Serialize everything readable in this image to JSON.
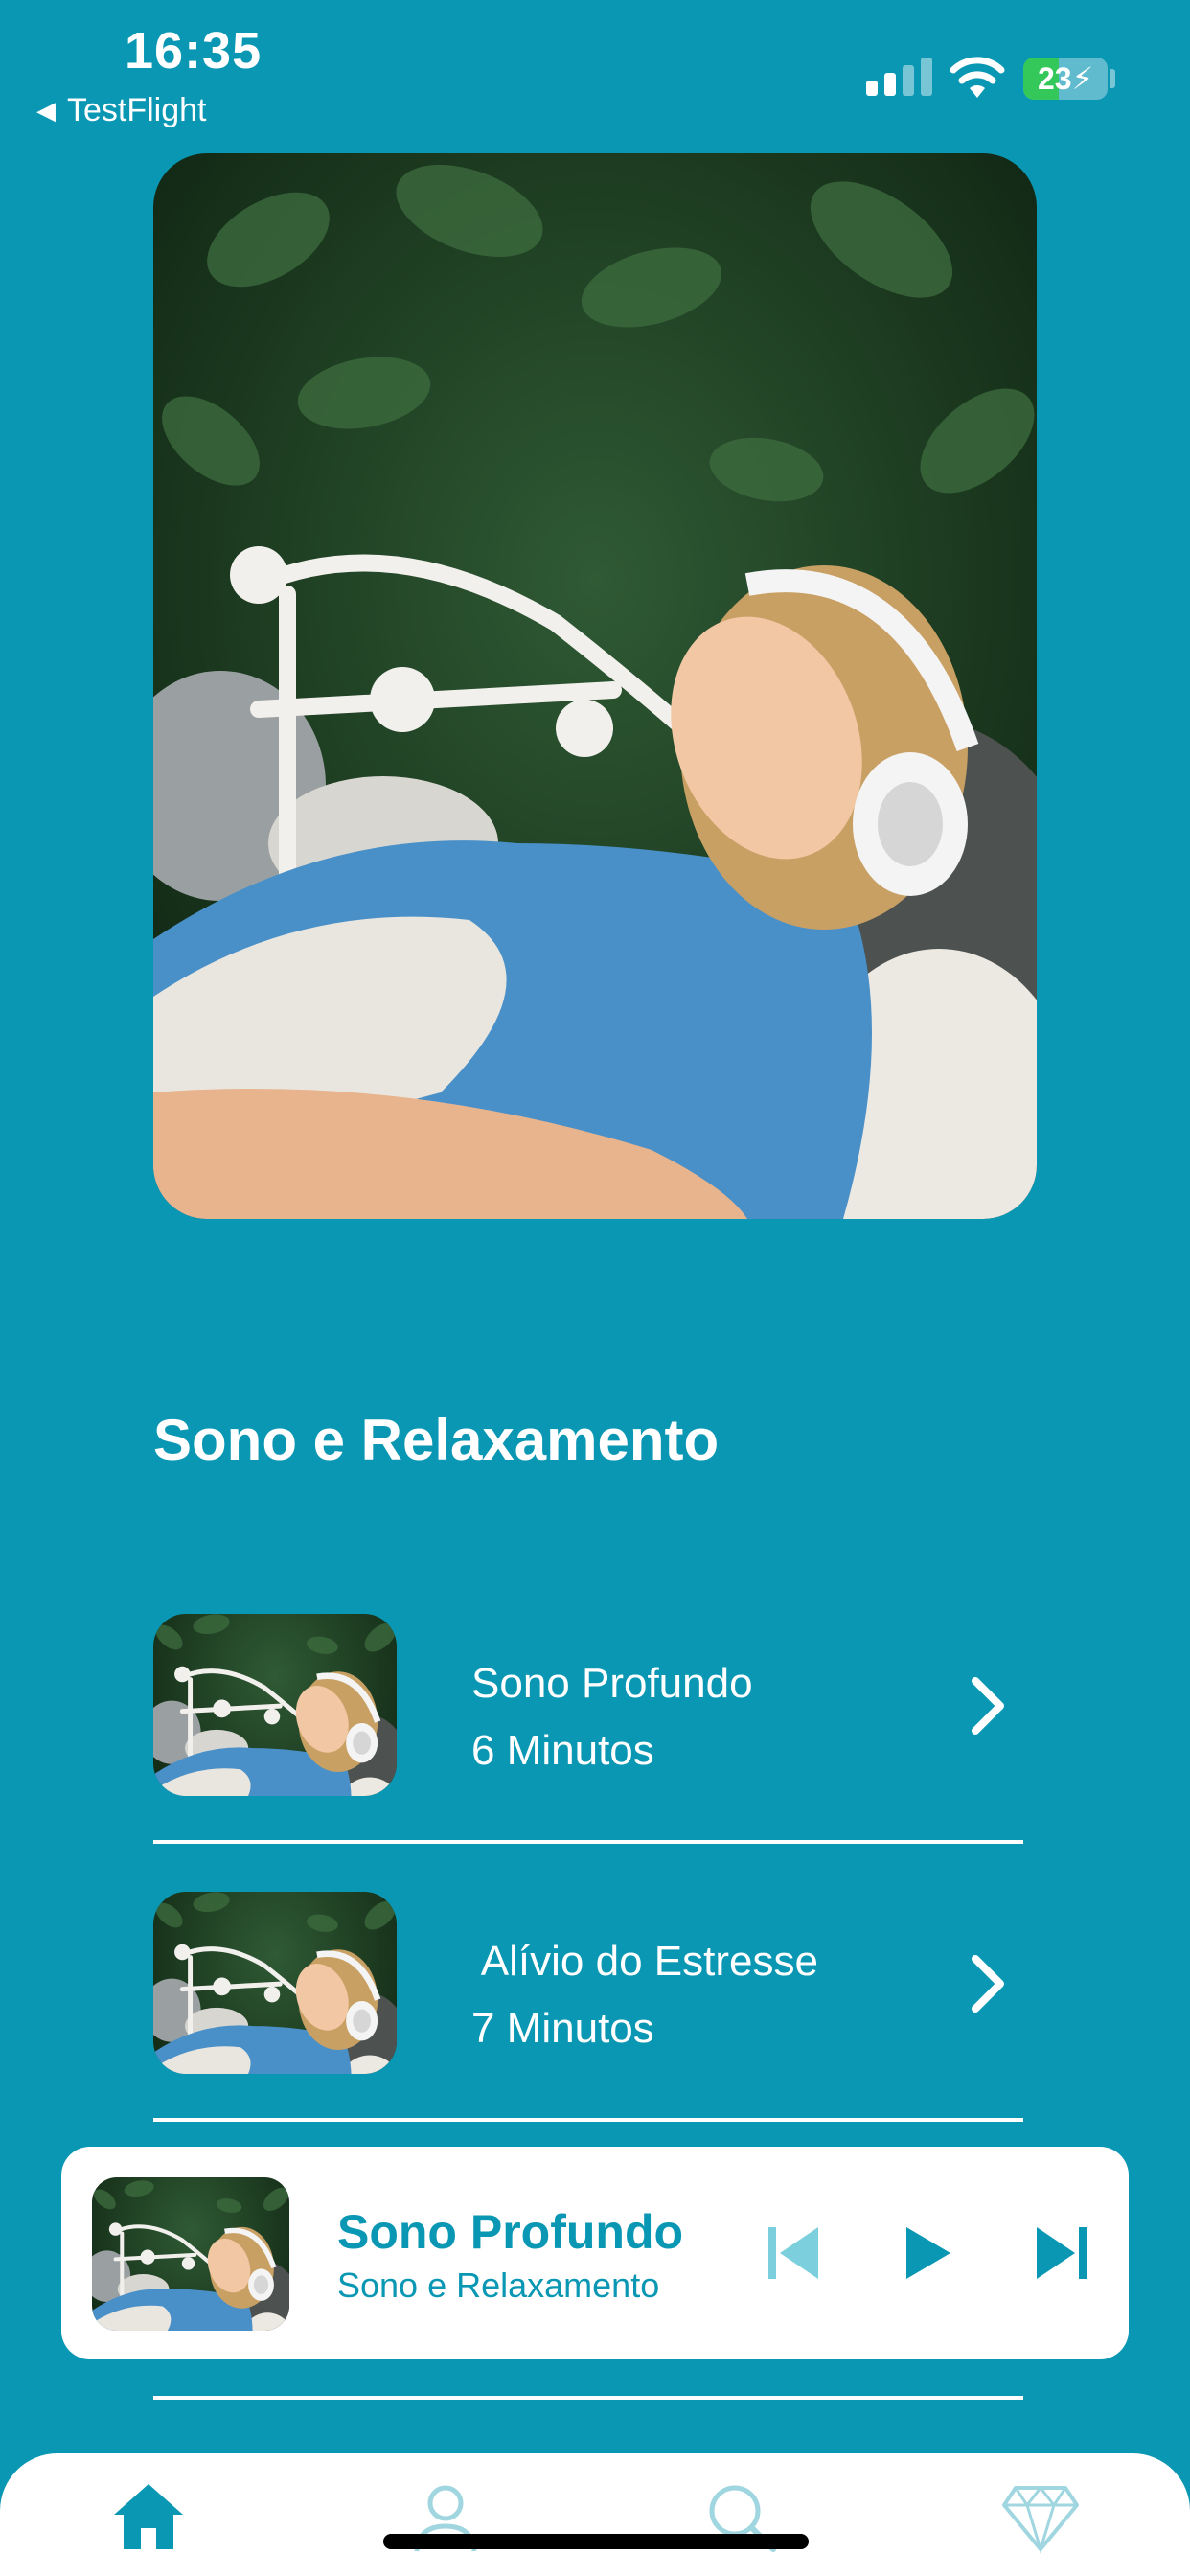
{
  "status_bar": {
    "time": "16:35",
    "back_label": "TestFlight",
    "battery": "23"
  },
  "colors": {
    "background": "#0a97b3",
    "accent": "#0a97b3",
    "card": "#ffffff",
    "battery_fill": "#34c759"
  },
  "section": {
    "title": "Sono e Relaxamento"
  },
  "tracks": [
    {
      "title": "Sono Profundo",
      "duration": "6 Minutos"
    },
    {
      "title": " Alívio do Estresse",
      "duration": "7 Minutos"
    }
  ],
  "player": {
    "title": "Sono Profundo",
    "subtitle": "Sono e Relaxamento",
    "icons": [
      "previous-icon",
      "play-icon",
      "next-icon"
    ]
  },
  "tabbar": {
    "icons": [
      "home-icon",
      "profile-icon",
      "search-icon",
      "diamond-icon"
    ],
    "active": "home-icon"
  }
}
